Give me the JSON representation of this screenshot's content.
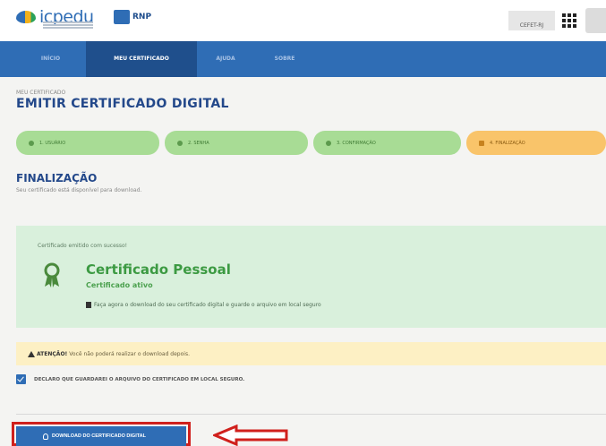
{
  "header": {
    "logo_text": "icpedu",
    "partner_text": "RNP",
    "institution_label": "CEFET-RJ",
    "apps_icon": "grid-apps-icon",
    "user_icon": "user-avatar-icon"
  },
  "nav": {
    "items": [
      {
        "label": "INÍCIO"
      },
      {
        "label": "MEU CERTIFICADO"
      },
      {
        "label": "AJUDA"
      },
      {
        "label": "SOBRE"
      }
    ],
    "active_index": 1
  },
  "page": {
    "breadcrumb": "MEU CERTIFICADO",
    "title": "EMITIR CERTIFICADO DIGITAL"
  },
  "steps": [
    {
      "label": "1. USUÁRIO",
      "icon": "user-icon"
    },
    {
      "label": "2. SENHA",
      "icon": "lock-icon"
    },
    {
      "label": "3. CONFIRMAÇÃO",
      "icon": "check-circle-icon"
    },
    {
      "label": "4. FINALIZAÇÃO",
      "icon": "flag-icon",
      "current": true
    }
  ],
  "section": {
    "title": "FINALIZAÇÃO",
    "subtitle": "Seu certificado está disponível para download."
  },
  "success": {
    "message": "Certificado emitido com sucesso!",
    "cert_name": "Certificado Pessoal",
    "cert_status": "Certificado ativo",
    "note": "Faça agora o download do seu certificado digital e guarde o arquivo em local seguro"
  },
  "warning": {
    "strong": "ATENÇÃO!",
    "text": "Você não poderá realizar o download depois."
  },
  "declaration": {
    "label": "DECLARO QUE GUARDAREI O ARQUIVO DO CERTIFICADO EM LOCAL SEGURO.",
    "checked": true
  },
  "download": {
    "label": "DOWNLOAD DO CERTIFICADO DIGITAL"
  },
  "colors": {
    "primary": "#2f6db5",
    "nav_active": "#1f4f8c",
    "step_done": "#a8dc95",
    "step_current": "#f9c46a",
    "success_bg": "#d9f0dc",
    "warning_bg": "#fdf0c4",
    "highlight": "#d0201c"
  }
}
